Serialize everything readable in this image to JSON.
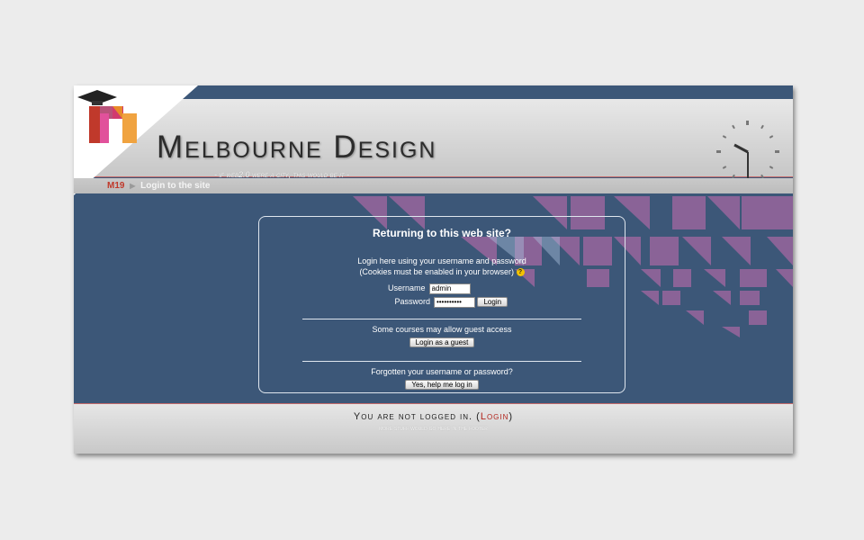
{
  "header": {
    "site_title": "Melbourne Design",
    "tagline": "- if web2.0 were a city, this would be it -"
  },
  "breadcrumb": {
    "home": "M19",
    "current": "Login to the site"
  },
  "login": {
    "heading": "Returning to this web site?",
    "description_line1": "Login here using your username and password",
    "description_line2": "(Cookies must be enabled in your browser)",
    "help_symbol": "?",
    "username_label": "Username",
    "username_value": "admin",
    "password_label": "Password",
    "password_value": "••••••••••",
    "login_button": "Login",
    "guest_text": "Some courses may allow guest access",
    "guest_button": "Login as a guest",
    "forgot_text": "Forgotten your username or password?",
    "forgot_button": "Yes, help me log in"
  },
  "footer": {
    "status_prefix": "You are not logged in. (",
    "status_link": "Login",
    "status_suffix": ")",
    "note": "more stuff would go here in the footer"
  },
  "colors": {
    "background": "#3c5778",
    "accent_red": "#c0392b",
    "logo_magenta": "#d9297a",
    "logo_orange": "#f39c12",
    "logo_red": "#c0392b"
  },
  "icons": [
    "graduation-cap-logo",
    "clock-icon",
    "breadcrumb-arrow-icon",
    "help-icon"
  ]
}
